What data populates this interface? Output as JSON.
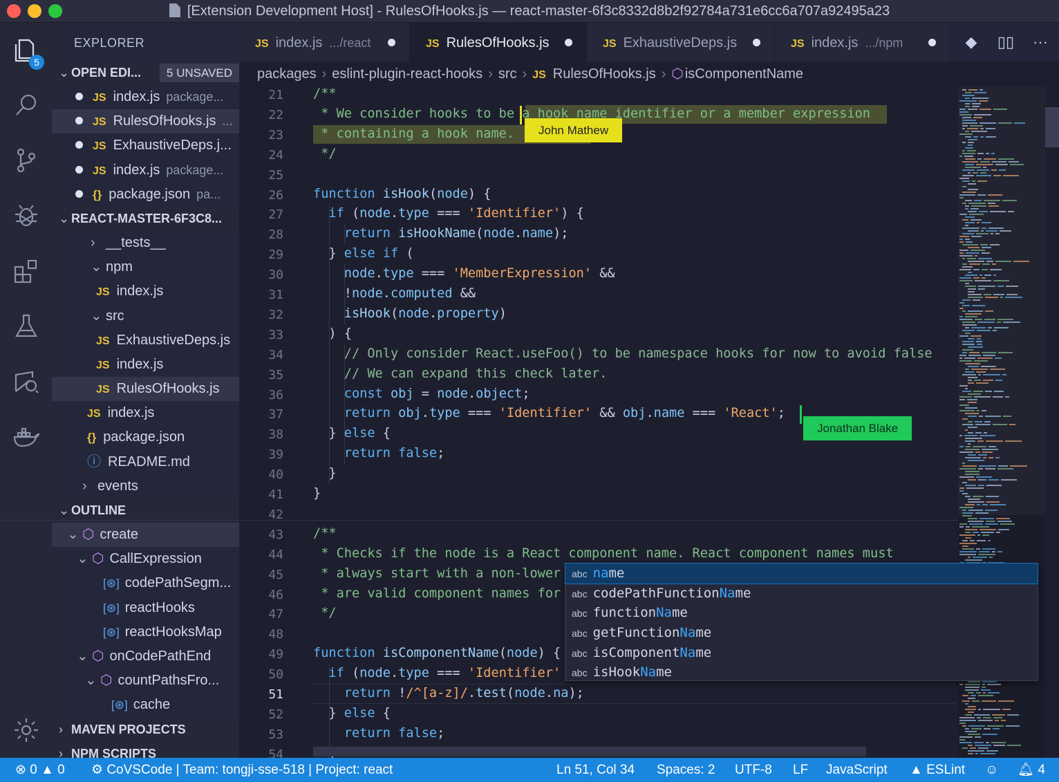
{
  "window": {
    "title": "[Extension Development Host] - RulesOfHooks.js — react-master-6f3c8332d8b2f92784a731e6cc6a707a92495a23",
    "traffic_lights": {
      "close": "#ff5f57",
      "minimize": "#febc2e",
      "maximize": "#28c840"
    }
  },
  "activity_bar": {
    "items": [
      {
        "name": "files-icon",
        "badge": "5",
        "active": true
      },
      {
        "name": "search-icon"
      },
      {
        "name": "source-control-icon"
      },
      {
        "name": "debug-icon"
      },
      {
        "name": "extensions-icon"
      },
      {
        "name": "testing-flask-icon"
      },
      {
        "name": "live-share-icon"
      },
      {
        "name": "docker-icon"
      }
    ],
    "settings_icon": "gear-icon"
  },
  "explorer": {
    "header": "EXPLORER",
    "open_editors": {
      "label": "OPEN EDI...",
      "unsaved": "5 UNSAVED",
      "items": [
        {
          "icon": "JS",
          "name": "index.js",
          "path": "package..."
        },
        {
          "icon": "JS",
          "name": "RulesOfHooks.js",
          "path": "...",
          "selected": true
        },
        {
          "icon": "JS",
          "name": "ExhaustiveDeps.j...",
          "path": ""
        },
        {
          "icon": "JS",
          "name": "index.js",
          "path": "package..."
        },
        {
          "icon": "{}",
          "name": "package.json",
          "path": "pa..."
        }
      ]
    },
    "folder": {
      "label": "REACT-MASTER-6F3C8...",
      "items": [
        {
          "chev": "›",
          "icon": "",
          "name": "__tests__",
          "indent": 56
        },
        {
          "chev": "⌄",
          "icon": "",
          "name": "npm",
          "indent": 56
        },
        {
          "chev": "",
          "icon": "JS",
          "name": "index.js",
          "indent": 64
        },
        {
          "chev": "⌄",
          "icon": "",
          "name": "src",
          "indent": 56
        },
        {
          "chev": "",
          "icon": "JS",
          "name": "ExhaustiveDeps.js",
          "indent": 64
        },
        {
          "chev": "",
          "icon": "JS",
          "name": "index.js",
          "indent": 64
        },
        {
          "chev": "",
          "icon": "JS",
          "name": "RulesOfHooks.js",
          "indent": 64,
          "selected": true
        },
        {
          "chev": "",
          "icon": "JS",
          "name": "index.js",
          "indent": 51
        },
        {
          "chev": "",
          "icon": "{}",
          "name": "package.json",
          "indent": 51
        },
        {
          "chev": "",
          "icon": "ⓘ",
          "name": "README.md",
          "indent": 51
        },
        {
          "chev": "›",
          "icon": "",
          "name": "events",
          "indent": 44
        }
      ]
    },
    "outline": {
      "label": "OUTLINE",
      "items": [
        {
          "chev": "⌄",
          "icon": "cube",
          "name": "create",
          "indent": 22,
          "selected": true
        },
        {
          "chev": "⌄",
          "icon": "cube",
          "name": "CallExpression",
          "indent": 36
        },
        {
          "chev": "",
          "icon": "var",
          "name": "codePathSegm...",
          "indent": 74
        },
        {
          "chev": "",
          "icon": "var",
          "name": "reactHooks",
          "indent": 74
        },
        {
          "chev": "",
          "icon": "var",
          "name": "reactHooksMap",
          "indent": 74
        },
        {
          "chev": "⌄",
          "icon": "cube",
          "name": "onCodePathEnd",
          "indent": 36
        },
        {
          "chev": "⌄",
          "icon": "cube",
          "name": "countPathsFro...",
          "indent": 48
        },
        {
          "chev": "",
          "icon": "var",
          "name": "cache",
          "indent": 86
        }
      ]
    },
    "maven": "MAVEN PROJECTS",
    "npm_scripts": "NPM SCRIPTS"
  },
  "tabs": [
    {
      "icon": "JS",
      "name": "index.js",
      "path": ".../react",
      "modified": true
    },
    {
      "icon": "JS",
      "name": "RulesOfHooks.js",
      "path": "",
      "modified": true,
      "active": true
    },
    {
      "icon": "JS",
      "name": "ExhaustiveDeps.js",
      "path": "",
      "modified": true
    },
    {
      "icon": "JS",
      "name": "index.js",
      "path": ".../npm",
      "modified": true
    }
  ],
  "breadcrumb": {
    "parts": [
      "packages",
      "eslint-plugin-react-hooks",
      "src"
    ],
    "file": "RulesOfHooks.js",
    "symbol": "isComponentName"
  },
  "editor": {
    "current_line": 51,
    "lines": [
      {
        "n": "21",
        "t": "/**"
      },
      {
        "n": "22",
        "t": " * We consider hooks to be a hook name identifier or a member expression"
      },
      {
        "n": "23",
        "t": " * containing a hook name."
      },
      {
        "n": "24",
        "t": " */"
      },
      {
        "n": "25",
        "t": ""
      },
      {
        "n": "26",
        "t": "function isHook(node) {"
      },
      {
        "n": "27",
        "t": "  if (node.type === 'Identifier') {"
      },
      {
        "n": "28",
        "t": "    return isHookName(node.name);"
      },
      {
        "n": "29",
        "t": "  } else if ("
      },
      {
        "n": "30",
        "t": "    node.type === 'MemberExpression' &&"
      },
      {
        "n": "31",
        "t": "    !node.computed &&"
      },
      {
        "n": "32",
        "t": "    isHook(node.property)"
      },
      {
        "n": "33",
        "t": "  ) {"
      },
      {
        "n": "34",
        "t": "    // Only consider React.useFoo() to be namespace hooks for now to avoid false"
      },
      {
        "n": "35",
        "t": "    // We can expand this check later."
      },
      {
        "n": "36",
        "t": "    const obj = node.object;"
      },
      {
        "n": "37",
        "t": "    return obj.type === 'Identifier' && obj.name === 'React';"
      },
      {
        "n": "38",
        "t": "  } else {"
      },
      {
        "n": "39",
        "t": "    return false;"
      },
      {
        "n": "40",
        "t": "  }"
      },
      {
        "n": "41",
        "t": "}"
      },
      {
        "n": "42",
        "t": ""
      },
      {
        "n": "43",
        "t": "/**"
      },
      {
        "n": "44",
        "t": " * Checks if the node is a React component name. React component names must"
      },
      {
        "n": "45",
        "t": " * always start with a non-lower"
      },
      {
        "n": "46",
        "t": " * are valid component names for"
      },
      {
        "n": "47",
        "t": " */"
      },
      {
        "n": "48",
        "t": ""
      },
      {
        "n": "49",
        "t": "function isComponentName(node) {"
      },
      {
        "n": "50",
        "t": "  if (node.type === 'Identifier'"
      },
      {
        "n": "51",
        "t": "    return !/^[a-z]/.test(node.na);"
      },
      {
        "n": "52",
        "t": "  } else {"
      },
      {
        "n": "53",
        "t": "    return false;"
      },
      {
        "n": "54",
        "t": "  }"
      }
    ]
  },
  "collaborators": [
    {
      "name": "John Mathew",
      "color": "#e6e01c",
      "text_color": "#1e1f2e"
    },
    {
      "name": "Jonathan Blake",
      "color": "#1fc95a",
      "text_color": "#10321c"
    }
  ],
  "suggestions": {
    "kind": "abc",
    "items": [
      {
        "pre": "",
        "match": "na",
        "post": "me",
        "selected": true
      },
      {
        "pre": "codePathFunction",
        "match": "Na",
        "post": "me"
      },
      {
        "pre": "function",
        "match": "Na",
        "post": "me"
      },
      {
        "pre": "getFunction",
        "match": "Na",
        "post": "me"
      },
      {
        "pre": "isComponent",
        "match": "Na",
        "post": "me"
      },
      {
        "pre": "isHook",
        "match": "Na",
        "post": "me"
      }
    ]
  },
  "status_bar": {
    "errors": "0",
    "warnings": "0",
    "left_text": "CoVSCode | Team: tongji-sse-518 | Project: react",
    "position": "Ln 51, Col 34",
    "spaces": "Spaces: 2",
    "encoding": "UTF-8",
    "eol": "LF",
    "language": "JavaScript",
    "eslint": "ESLint",
    "notifications": "4",
    "color": "#1b86dd"
  }
}
